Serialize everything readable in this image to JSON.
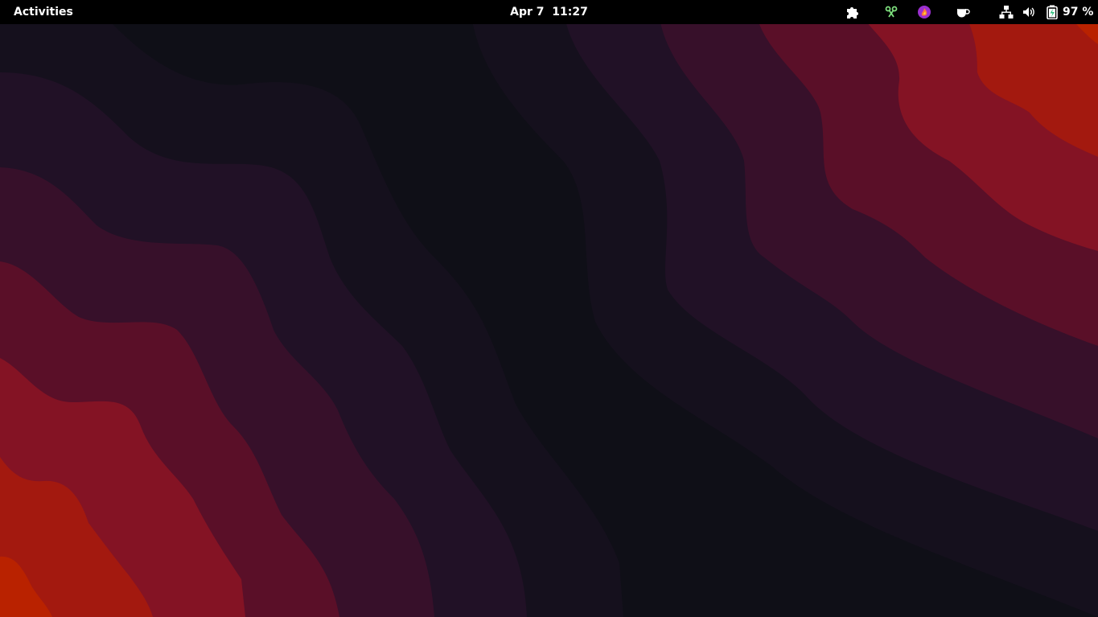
{
  "topbar": {
    "activities_label": "Activities",
    "clock": {
      "date": "Apr 7",
      "time": "11:27"
    },
    "tray": [
      {
        "icon": "extensions-puzzle-icon"
      },
      {
        "icon": "clipboard-scissors-icon",
        "color": "#7ee07e"
      },
      {
        "icon": "app-indicator-icon",
        "color": "#9b2fd0"
      },
      {
        "icon": "caffeine-cup-icon"
      }
    ],
    "system": {
      "network_icon": "wired-network-icon",
      "volume_icon": "volume-icon",
      "battery_icon": "battery-charging-icon",
      "battery_percent": "97 %",
      "battery_level": 0.97
    }
  },
  "wallpaper": {
    "colors": [
      "#0f0f17",
      "#15101d",
      "#211126",
      "#37102a",
      "#5a0f28",
      "#841324",
      "#a3190f",
      "#b92200"
    ]
  }
}
